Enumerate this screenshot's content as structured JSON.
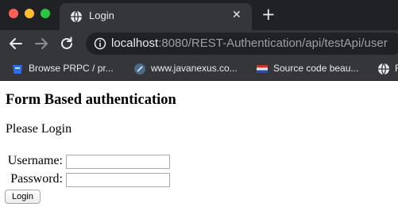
{
  "browser": {
    "tab": {
      "title": "Login",
      "favicon": "globe-icon",
      "close_glyph": "✕"
    },
    "new_tab_glyph": "+",
    "address_bar": {
      "host": "localhost",
      "rest": ":8080/REST-Authentication/api/testApi/user"
    },
    "bookmarks": [
      {
        "label": "Browse PRPC / pr...",
        "icon": "prpc-icon",
        "color": "#2f6ee0"
      },
      {
        "label": "www.javanexus.co...",
        "icon": "javanexus-icon",
        "color": "#4a6a8c"
      },
      {
        "label": "Source code beau...",
        "icon": "flag-icon",
        "color": "#c0392b"
      },
      {
        "label": "F",
        "icon": "globe-icon",
        "color": "#e8eaed"
      }
    ],
    "colors": {
      "chrome_dark": "#202124",
      "chrome_mid": "#35363a",
      "text_light": "#e8eaed"
    }
  },
  "page": {
    "heading": "Form Based authentication",
    "prompt": "Please Login",
    "form": {
      "username_label": "Username:",
      "username_value": "",
      "password_label": "Password:",
      "password_value": "",
      "submit_label": "Login"
    }
  }
}
